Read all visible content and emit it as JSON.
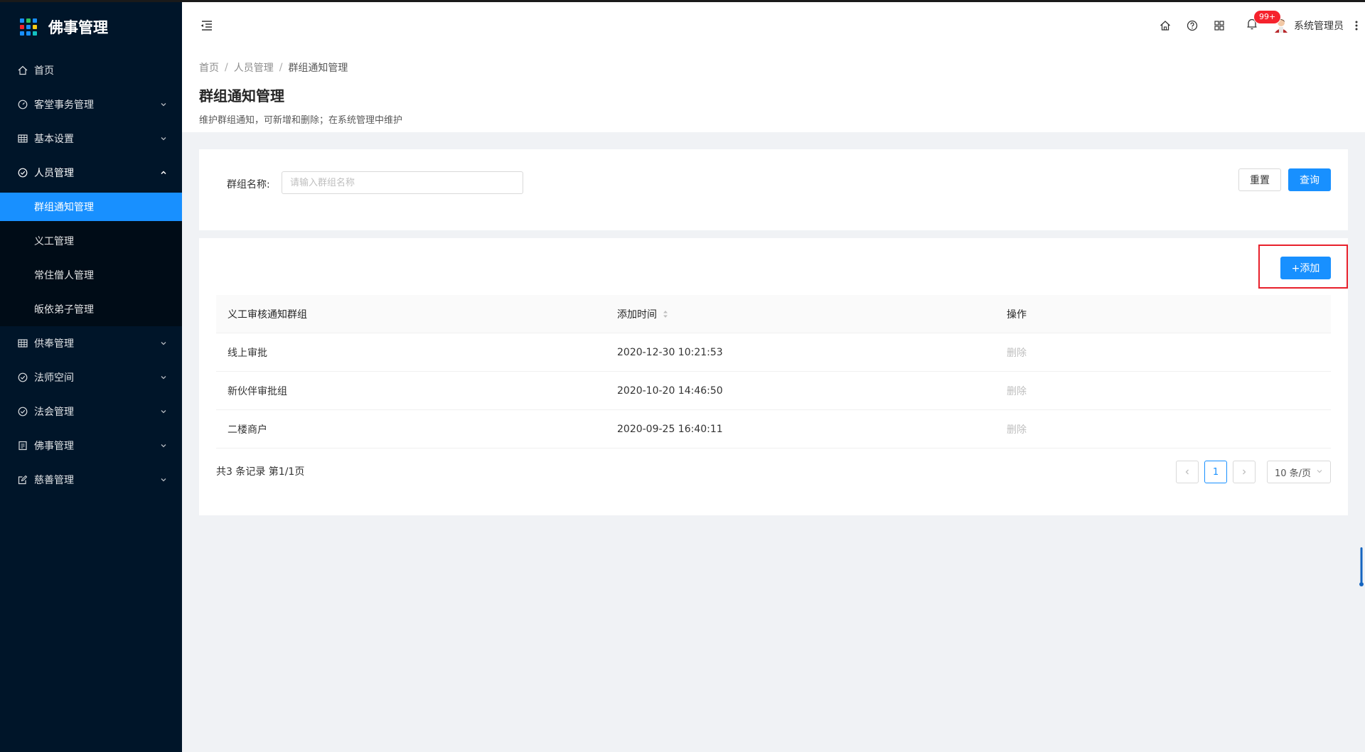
{
  "app": {
    "title": "佛事管理",
    "logo_colors": [
      "#1890ff",
      "#2fc25b",
      "#1890ff",
      "#f5222d",
      "#1890ff",
      "#facc14",
      "#1890ff",
      "#1890ff",
      "#13c2c2"
    ]
  },
  "sidebar": {
    "items": [
      {
        "label": "首页",
        "icon": "home-icon"
      },
      {
        "label": "客堂事务管理",
        "icon": "dashboard-icon"
      },
      {
        "label": "基本设置",
        "icon": "table-icon"
      },
      {
        "label": "人员管理",
        "icon": "check-circle-icon"
      }
    ],
    "submenu": [
      {
        "label": "群组通知管理",
        "active": true
      },
      {
        "label": "义工管理"
      },
      {
        "label": "常住僧人管理"
      },
      {
        "label": "皈依弟子管理"
      }
    ],
    "items_after": [
      {
        "label": "供奉管理",
        "icon": "table-icon"
      },
      {
        "label": "法师空间",
        "icon": "check-circle-icon"
      },
      {
        "label": "法会管理",
        "icon": "check-circle-icon"
      },
      {
        "label": "佛事管理",
        "icon": "profile-icon"
      },
      {
        "label": "慈善管理",
        "icon": "form-icon"
      }
    ]
  },
  "header": {
    "notification_badge": "99+",
    "user_name": "系统管理员"
  },
  "breadcrumb": {
    "items": [
      "首页",
      "人员管理"
    ],
    "current": "群组通知管理",
    "separator": "/"
  },
  "page": {
    "title": "群组通知管理",
    "description": "维护群组通知，可新增和删除；在系统管理中维护"
  },
  "search": {
    "label": "群组名称:",
    "placeholder": "请输入群组名称",
    "value": "",
    "reset_label": "重置",
    "query_label": "查询"
  },
  "table": {
    "add_label": "+添加",
    "columns": [
      "义工审核通知群组",
      "添加时间",
      "操作"
    ],
    "rows": [
      {
        "name": "线上审批",
        "time": "2020-12-30 10:21:53",
        "action": "删除"
      },
      {
        "name": "新伙伴审批组",
        "time": "2020-10-20 14:46:50",
        "action": "删除"
      },
      {
        "name": "二楼商户",
        "time": "2020-09-25 16:40:11",
        "action": "删除"
      }
    ]
  },
  "pagination": {
    "summary": "共3 条记录 第1/1页",
    "current_page": "1",
    "page_size": "10 条/页"
  },
  "colors": {
    "primary": "#1890ff",
    "sidebar_bg": "#001529",
    "highlight_border": "#e8202b",
    "badge": "#f5222d"
  }
}
